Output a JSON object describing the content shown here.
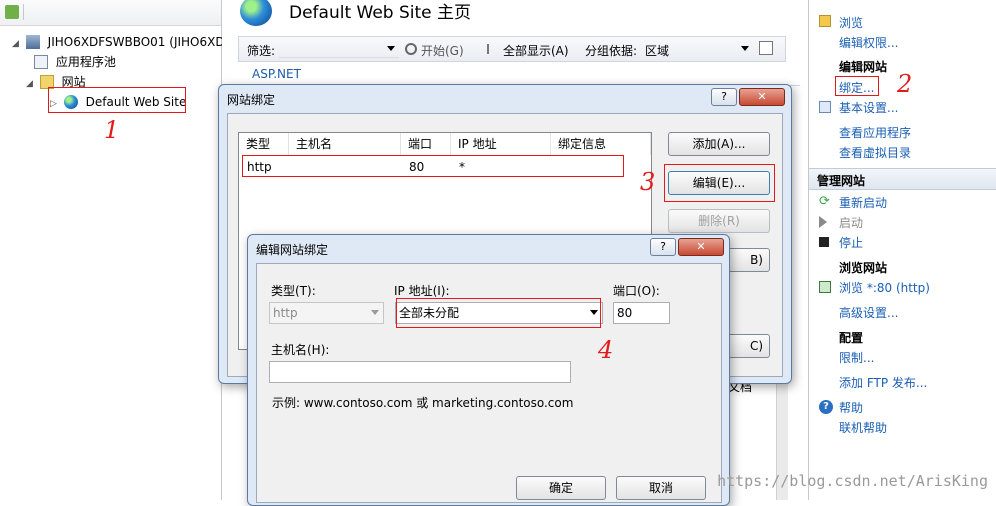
{
  "tree": {
    "server": "JIHO6XDFSWBBO01 (JIHO6XD",
    "app_pools": "应用程序池",
    "sites": "网站",
    "default_site": "Default Web Site"
  },
  "center": {
    "title": "Default Web Site 主页",
    "filter_label": "筛选:",
    "start_label": "开始(G)",
    "show_all_label": "全部显示(A)",
    "group_label": "分组依据:",
    "group_value": "区域",
    "section": "ASP.NET",
    "partial_text": "文档"
  },
  "actions": {
    "browse": "浏览",
    "edit_permissions": "编辑权限...",
    "edit_site_header": "编辑网站",
    "bindings": "绑定...",
    "basic_settings": "基本设置...",
    "view_apps": "查看应用程序",
    "view_vdirs": "查看虚拟目录",
    "manage_site_header": "管理网站",
    "restart": "重新启动",
    "start": "启动",
    "stop": "停止",
    "browse_site_header": "浏览网站",
    "browse_port": "浏览 *:80 (http)",
    "advanced": "高级设置...",
    "config_header": "配置",
    "limits": "限制...",
    "add_ftp": "添加 FTP 发布...",
    "help_label": "帮助",
    "online_help": "联机帮助"
  },
  "binding_dialog": {
    "title": "网站绑定",
    "help": "?",
    "close": "✕",
    "columns": [
      "类型",
      "主机名",
      "端口",
      "IP 地址",
      "绑定信息"
    ],
    "rows": [
      {
        "type": "http",
        "host": "",
        "port": "80",
        "ip": "*",
        "info": ""
      }
    ],
    "add": "添加(A)...",
    "edit": "编辑(E)...",
    "remove": "删除(R)",
    "browse_partial": "B)",
    "close_partial": "C)"
  },
  "edit_dialog": {
    "title": "编辑网站绑定",
    "help": "?",
    "close": "✕",
    "type_label": "类型(T):",
    "type_value": "http",
    "ip_label": "IP 地址(I):",
    "ip_value": "全部未分配",
    "port_label": "端口(O):",
    "port_value": "80",
    "host_label": "主机名(H):",
    "host_value": "",
    "example": "示例: www.contoso.com 或 marketing.contoso.com",
    "ok": "确定",
    "cancel": "取消"
  },
  "annotations": [
    "1",
    "2",
    "3",
    "4"
  ],
  "watermark": "https://blog.csdn.net/ArisKing",
  "colors": {
    "link": "#1a5fb4",
    "annotation": "#e21a1a",
    "dialog_frame": "#dfe9f5"
  }
}
